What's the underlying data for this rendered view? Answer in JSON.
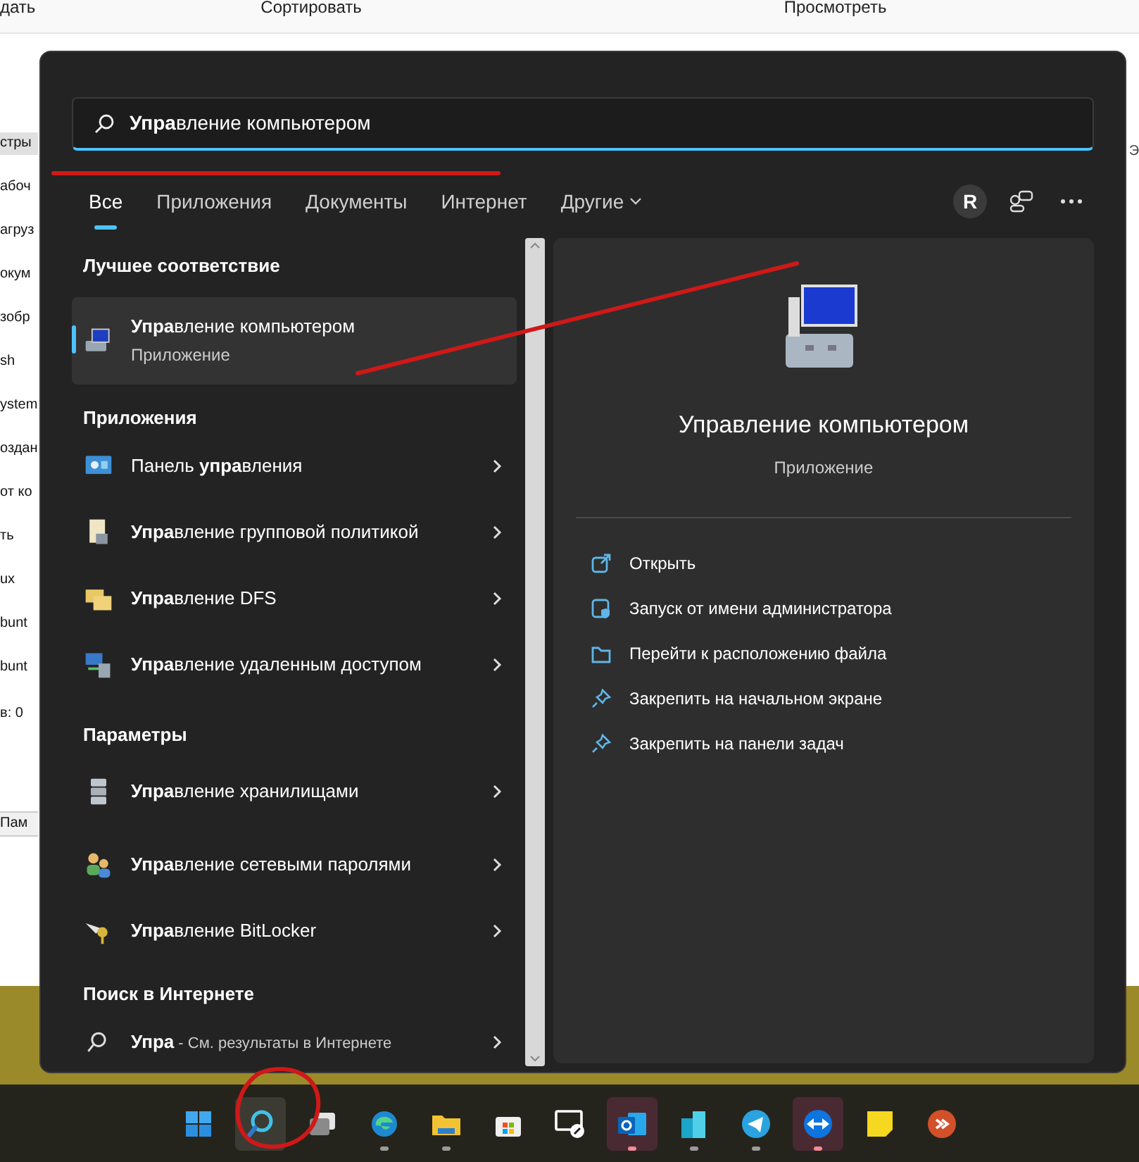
{
  "explorer": {
    "toolbar": [
      "дать",
      "Сортировать",
      "Просмотреть"
    ],
    "nav_items": [
      "стры",
      "абоч",
      "агруз",
      "окум",
      "зобр",
      "sh",
      "ystem",
      "оздан",
      "от ко",
      "ть",
      "ux",
      "bunt",
      "bunt"
    ],
    "status_text": "в: 0",
    "bottom_text": "Пам",
    "right_text": "Э"
  },
  "search": {
    "value": "**Упра**вление компьютером"
  },
  "tabs": [
    {
      "label": "Все",
      "selected": true,
      "kind": "tab"
    },
    {
      "label": "Приложения",
      "selected": false,
      "kind": "tab"
    },
    {
      "label": "Документы",
      "selected": false,
      "kind": "tab"
    },
    {
      "label": "Интернет",
      "selected": false,
      "kind": "tab"
    },
    {
      "label": "Другие",
      "selected": false,
      "kind": "dropdown"
    }
  ],
  "account_initial": "R",
  "best_match": {
    "heading": "Лучшее соответствие",
    "title": "**Упра**вление компьютером",
    "subtitle": "Приложение",
    "kind": "toolbox",
    "selected": true
  },
  "sections": [
    {
      "heading": "Приложения",
      "items": [
        {
          "kind": "control",
          "title": "Панель **упра**вления"
        },
        {
          "kind": "policy",
          "title": "**Упра**вление групповой политикой"
        },
        {
          "kind": "dfs",
          "title": "**Упра**вление DFS"
        },
        {
          "kind": "remote",
          "title": "**Упра**вление удаленным доступом"
        }
      ]
    },
    {
      "heading": "Параметры",
      "items": [
        {
          "kind": "storage",
          "title": "**Упра**вление хранилищами"
        },
        {
          "kind": "users",
          "title": "**Упра**вление сетевыми паролями"
        },
        {
          "kind": "key",
          "title": "**Упра**вление BitLocker"
        }
      ]
    },
    {
      "heading": "Поиск в Интернете",
      "items": [
        {
          "kind": "search",
          "title": "**Упра**",
          "suffix": " - См. результаты в Интернете"
        }
      ]
    }
  ],
  "preview": {
    "title": "Управление компьютером",
    "subtitle": "Приложение",
    "actions": [
      {
        "kind": "open",
        "label": "Открыть"
      },
      {
        "kind": "admin",
        "label": "Запуск от имени администратора"
      },
      {
        "kind": "folder",
        "label": "Перейти к расположению файла"
      },
      {
        "kind": "pin",
        "label": "Закрепить на начальном экране"
      },
      {
        "kind": "pin",
        "label": "Закрепить на панели задач"
      }
    ]
  },
  "taskbar": [
    {
      "kind": "start",
      "selected": false,
      "running": false,
      "attention": false
    },
    {
      "kind": "search",
      "selected": true,
      "running": false,
      "attention": false
    },
    {
      "kind": "taskview",
      "selected": false,
      "running": false,
      "attention": false
    },
    {
      "kind": "browser",
      "selected": false,
      "running": true,
      "attention": false
    },
    {
      "kind": "files",
      "selected": false,
      "running": true,
      "attention": false
    },
    {
      "kind": "store",
      "selected": false,
      "running": false,
      "attention": false
    },
    {
      "kind": "monitor",
      "selected": false,
      "running": false,
      "attention": false
    },
    {
      "kind": "mail",
      "selected": false,
      "running": true,
      "attention": true
    },
    {
      "kind": "buildings",
      "selected": false,
      "running": true,
      "attention": false
    },
    {
      "kind": "plane",
      "selected": false,
      "running": true,
      "attention": false
    },
    {
      "kind": "arrows",
      "selected": false,
      "running": true,
      "attention": true
    },
    {
      "kind": "note",
      "selected": false,
      "running": false,
      "attention": false
    },
    {
      "kind": "rdp",
      "selected": false,
      "running": false,
      "attention": false
    }
  ]
}
